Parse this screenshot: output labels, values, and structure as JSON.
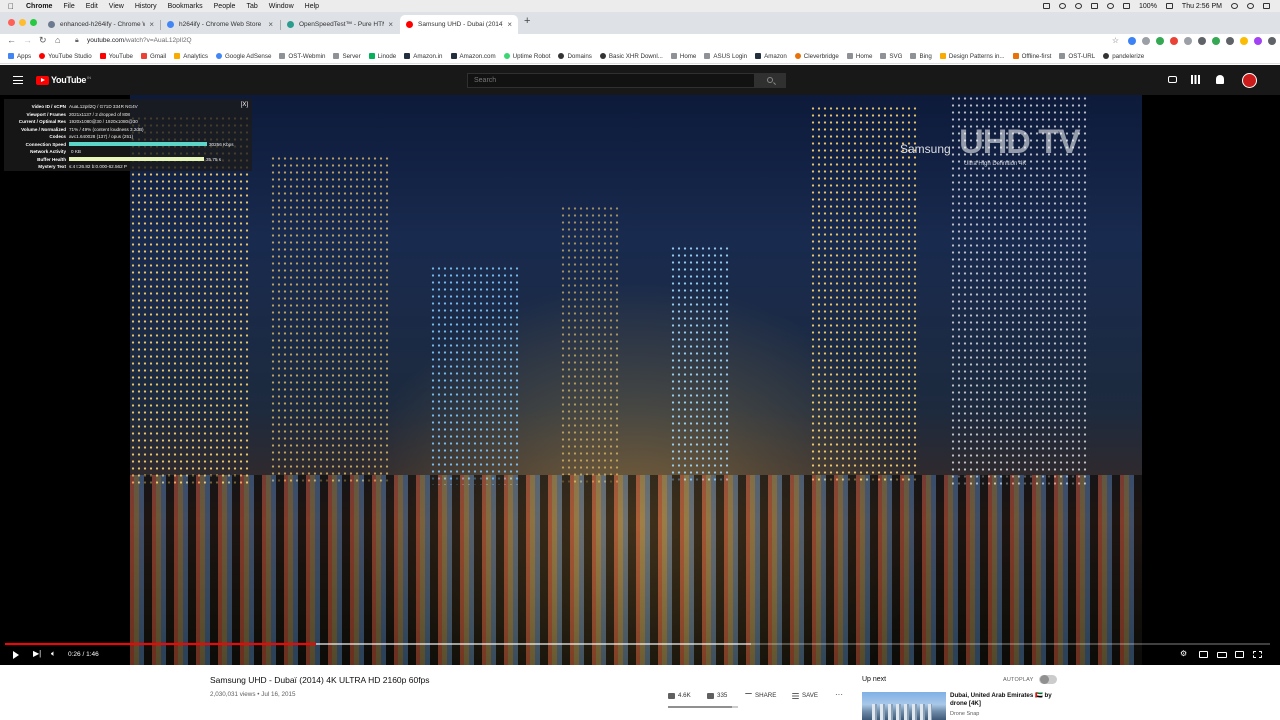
{
  "menubar": {
    "app_name": "Chrome",
    "items": [
      "File",
      "Edit",
      "View",
      "History",
      "Bookmarks",
      "People",
      "Tab",
      "Window",
      "Help"
    ],
    "battery": "100%",
    "clock": "Thu 2:56 PM"
  },
  "tabs": [
    {
      "title": "enhanced-h264ify - Chrome W",
      "color": "#6b7a8f",
      "active": false
    },
    {
      "title": "h264ify - Chrome Web Store",
      "color": "#4285f4",
      "active": false
    },
    {
      "title": "OpenSpeedTest™ - Pure HTML",
      "color": "#2a9d8f",
      "active": false
    },
    {
      "title": "Samsung UHD - Dubai (2014)",
      "color": "#ff0000",
      "active": true
    }
  ],
  "toolbar": {
    "url_host": "youtube.com",
    "url_path": "/watch?v=AuaL12pIl2Q"
  },
  "bookmarks": [
    "Apps",
    "YouTube Studio",
    "YouTube",
    "Gmail",
    "Analytics",
    "Google AdSense",
    "OST-Webmin",
    "Server",
    "Linode",
    "Amazon.in",
    "Amazon.com",
    "Uptime Robot",
    "Domains",
    "Basic XHR Downl...",
    "Home",
    "ASUS Login",
    "Amazon",
    "Cleverbridge",
    "Home",
    "SVG",
    "Bing",
    "Design Patterns in...",
    "Offline-first",
    "OST-URL",
    "pandelerize"
  ],
  "youtube": {
    "logo": "YouTube",
    "logo_sup": "IN",
    "search_placeholder": "Search"
  },
  "video": {
    "watermark_brand": "Samsung",
    "watermark_main": "UHD TV",
    "watermark_sub": "Ultra High Definition 4K",
    "time": "0:26 / 1:46",
    "progress": 0.246,
    "buffered": 0.59
  },
  "stats": {
    "rows": [
      {
        "label": "Video ID / sCPN",
        "value": "AuaL12pIl2Q / G71D 334R NG4V"
      },
      {
        "label": "Viewport / Frames",
        "value": "2021x1137 / 2 dropped of 808"
      },
      {
        "label": "Current / Optimal Res",
        "value": "1920x1080@30 / 1920x1080@30"
      },
      {
        "label": "Volume / Normalized",
        "value": "71% / 49% (content loudness 3.2dB)"
      },
      {
        "label": "Codecs",
        "value": "avc1.640028 (137) / opus (251)"
      },
      {
        "label": "Connection Speed",
        "value": "30256 Kbps",
        "bar": 0.92,
        "color": "#5dd4c8"
      },
      {
        "label": "Network Activity",
        "value": "0 KB",
        "bar": 0.0,
        "color": "#ffffff"
      },
      {
        "label": "Buffer Health",
        "value": "35.75 s",
        "bar": 0.9,
        "color": "#e8f5b8"
      },
      {
        "label": "Mystery Text",
        "value": "s:4 t:26.82 b:0.000-62.562 P"
      }
    ]
  },
  "meta": {
    "title": "Samsung UHD - Dubaï (2014) 4K ULTRA HD 2160p 60fps",
    "views": "2,030,031 views • Jul 16, 2015",
    "likes": "4.6K",
    "dislikes": "335",
    "share": "SHARE",
    "save": "SAVE"
  },
  "sidebar": {
    "up_next": "Up next",
    "autoplay": "AUTOPLAY",
    "rec_title": "Dubai, United Arab Emirates 🇦🇪 by drone [4K]",
    "rec_channel": "Drone Snap"
  }
}
